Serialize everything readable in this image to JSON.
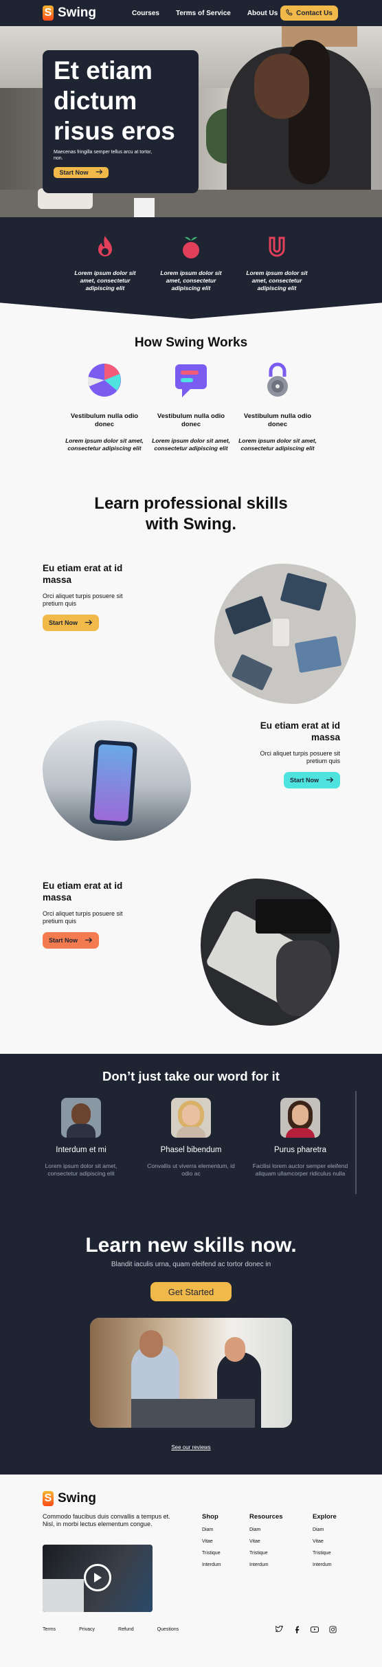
{
  "header": {
    "brand": "Swing",
    "logo_letter": "S",
    "nav": [
      "Courses",
      "Terms of Service",
      "About Us"
    ],
    "contact_label": "Contact Us"
  },
  "hero": {
    "title": "Et etiam dictum risus eros",
    "subtitle": "Maecenas fringilla semper tellus arcu at tortor, non.",
    "button_label": "Start Now"
  },
  "features": [
    {
      "icon": "flame-icon",
      "text": "Lorem ipsum dolor sit amet, consectetur adipiscing elit",
      "color": "#e2405a"
    },
    {
      "icon": "apple-icon",
      "text": "Lorem ipsum dolor sit amet, consectetur adipiscing elit",
      "color": "#e2405a"
    },
    {
      "icon": "magnet-icon",
      "text": "Lorem ipsum dolor sit amet, consectetur adipiscing elit",
      "color": "#e2405a"
    }
  ],
  "how": {
    "title": "How Swing Works",
    "items": [
      {
        "icon": "pie-chart-icon",
        "title": "Vestibulum nulla odio donec",
        "text": "Lorem ipsum dolor sit amet, consectetur adipiscing elit"
      },
      {
        "icon": "chat-bubble-icon",
        "title": "Vestibulum nulla odio donec",
        "text": "Lorem ipsum dolor sit amet, consectetur adipiscing elit"
      },
      {
        "icon": "padlock-icon",
        "title": "Vestibulum nulla odio donec",
        "text": "Lorem ipsum dolor sit amet, consectetur adipiscing elit"
      }
    ]
  },
  "learn": {
    "title": "Learn professional skills with Swing.",
    "sections": [
      {
        "heading": "Eu etiam erat at id massa",
        "text": "Orci aliquet turpis posuere sit pretium quis",
        "button": "Start Now",
        "color": "#f0b94a"
      },
      {
        "heading": "Eu etiam erat at id massa",
        "text": "Orci aliquet turpis posuere sit pretium quis",
        "button": "Start Now",
        "color": "#4fe3df"
      },
      {
        "heading": "Eu etiam erat at id massa",
        "text": "Orci aliquet turpis posuere sit pretium quis",
        "button": "Start Now",
        "color": "#f47b4f"
      }
    ]
  },
  "testimonials": {
    "title": "Don’t just take our word for it",
    "items": [
      {
        "name": "Interdum et mi",
        "text": "Lorem ipsum dolor sit amet, consectetur adipiscing elit"
      },
      {
        "name": "Phasel bibendum",
        "text": "Convallis ut viverra elementum, id odio ac"
      },
      {
        "name": "Purus pharetra",
        "text": "Facilisi lorem auctor semper eleifend aliquam ullamcorper ridiculus nulla"
      }
    ]
  },
  "cta": {
    "title": "Learn new skills now.",
    "subtitle": "Blandit iaculis urna, quam eleifend ac tortor donec in",
    "button": "Get Started",
    "reviews_link": "See our reviews"
  },
  "footer": {
    "brand": "Swing",
    "description": "Commodo faucibus duis convallis a tempus et. Nisl, in morbi lectus elementum congue.",
    "columns": [
      {
        "title": "Shop",
        "items": [
          "Diam",
          "Vitae",
          "Tristique",
          "Interdum"
        ]
      },
      {
        "title": "Resources",
        "items": [
          "Diam",
          "Vitae",
          "Tristique",
          "Interdum"
        ]
      },
      {
        "title": "Explore",
        "items": [
          "Diam",
          "Vitae",
          "Tristique",
          "Interdum"
        ]
      }
    ],
    "bottom_links": [
      "Terms",
      "Privacy",
      "Refund",
      "Questions"
    ],
    "social": [
      "twitter-icon",
      "facebook-icon",
      "youtube-icon",
      "instagram-icon"
    ]
  }
}
